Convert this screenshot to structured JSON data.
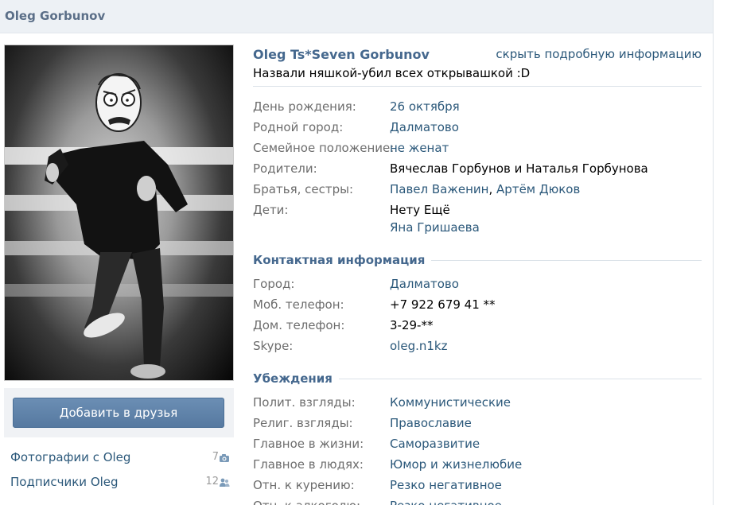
{
  "header": {
    "name": "Oleg Gorbunov"
  },
  "profile": {
    "full_name": "Oleg Ts*Seven Gorbunov",
    "hide_link": "скрыть подробную информацию",
    "status": "Назвали няшкой-убил всех открывашкой :D"
  },
  "sidebar": {
    "add_friend": "Добавить в друзья",
    "photos_label": "Фотографии с Oleg",
    "photos_count": "7",
    "followers_label": "Подписчики Oleg",
    "followers_count": "12"
  },
  "info": {
    "birthday": {
      "label": "День рождения:",
      "value": "26 октября"
    },
    "hometown": {
      "label": "Родной город:",
      "value": "Далматово"
    },
    "relationship": {
      "label": "Семейное положение:",
      "value": "не женат"
    },
    "parents": {
      "label": "Родители:",
      "value": "Вячеслав Горбунов и Наталья Горбунова"
    },
    "siblings": {
      "label": "Братья, сестры:",
      "value1": "Павел Важенин",
      "separator": ",",
      "value2": "Артём Дюков"
    },
    "children": {
      "label": "Дети:",
      "value1": "Нету Ещё",
      "value2": "Яна Гришаева"
    }
  },
  "contacts": {
    "title": "Контактная информация",
    "city": {
      "label": "Город:",
      "value": "Далматово"
    },
    "mobile": {
      "label": "Моб. телефон:",
      "value": "+7 922 679 41 **"
    },
    "home": {
      "label": "Дом. телефон:",
      "value": "3-29-**"
    },
    "skype": {
      "label": "Skype:",
      "value": "oleg.n1kz"
    }
  },
  "beliefs": {
    "title": "Убеждения",
    "political": {
      "label": "Полит. взгляды:",
      "value": "Коммунистические"
    },
    "religious": {
      "label": "Религ. взгляды:",
      "value": "Православие"
    },
    "life_main": {
      "label": "Главное в жизни:",
      "value": "Саморазвитие"
    },
    "people_main": {
      "label": "Главное в людях:",
      "value": "Юмор и жизнелюбие"
    },
    "smoking": {
      "label": "Отн. к курению:",
      "value": "Резко негативное"
    },
    "alcohol": {
      "label": "Отн. к алкоголю:",
      "value": "Резко негативное"
    }
  },
  "colors": {
    "link": "#2b587a",
    "title": "#45688e",
    "label": "#6d6d6d",
    "button": "#5e82a8"
  }
}
